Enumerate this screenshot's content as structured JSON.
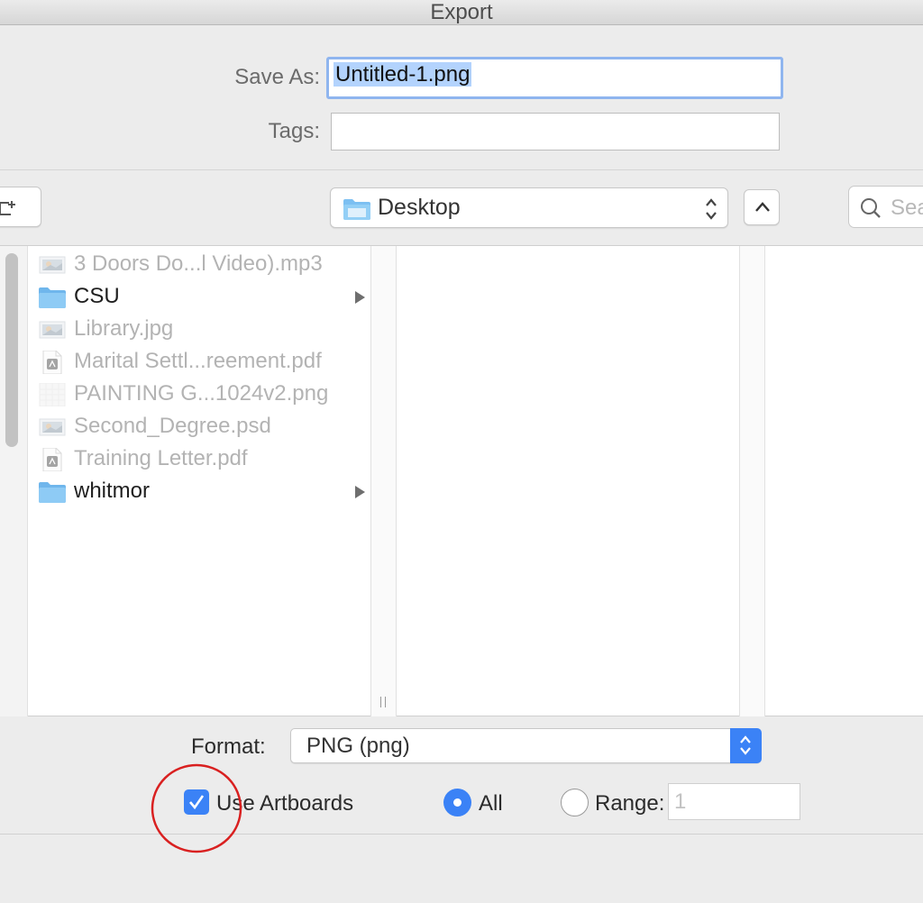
{
  "window": {
    "title": "Export"
  },
  "save_as": {
    "label": "Save As:",
    "value": "Untitled-1.png"
  },
  "tags": {
    "label": "Tags:",
    "value": ""
  },
  "location": {
    "current": "Desktop"
  },
  "search": {
    "placeholder": "Sea"
  },
  "files": [
    {
      "name": "3 Doors Do...l Video).mp3",
      "kind": "image-thumb",
      "enabled": false,
      "folder": false
    },
    {
      "name": "CSU",
      "kind": "folder",
      "enabled": true,
      "folder": true
    },
    {
      "name": "Library.jpg",
      "kind": "image-thumb",
      "enabled": false,
      "folder": false
    },
    {
      "name": "Marital Settl...reement.pdf",
      "kind": "pdf",
      "enabled": false,
      "folder": false
    },
    {
      "name": "PAINTING G...1024v2.png",
      "kind": "grid-thumb",
      "enabled": false,
      "folder": false
    },
    {
      "name": "Second_Degree.psd",
      "kind": "image-thumb",
      "enabled": false,
      "folder": false
    },
    {
      "name": "Training Letter.pdf",
      "kind": "pdf",
      "enabled": false,
      "folder": false
    },
    {
      "name": "whitmor",
      "kind": "folder",
      "enabled": true,
      "folder": true
    }
  ],
  "format": {
    "label": "Format:",
    "value": "PNG (png)"
  },
  "options": {
    "use_artboards_label": "Use Artboards",
    "use_artboards_checked": true,
    "all_label": "All",
    "range_label": "Range:",
    "range_value": "1"
  },
  "colors": {
    "accent": "#3b82f6",
    "folder": "#7cc0f2",
    "annotation": "#d92020"
  }
}
